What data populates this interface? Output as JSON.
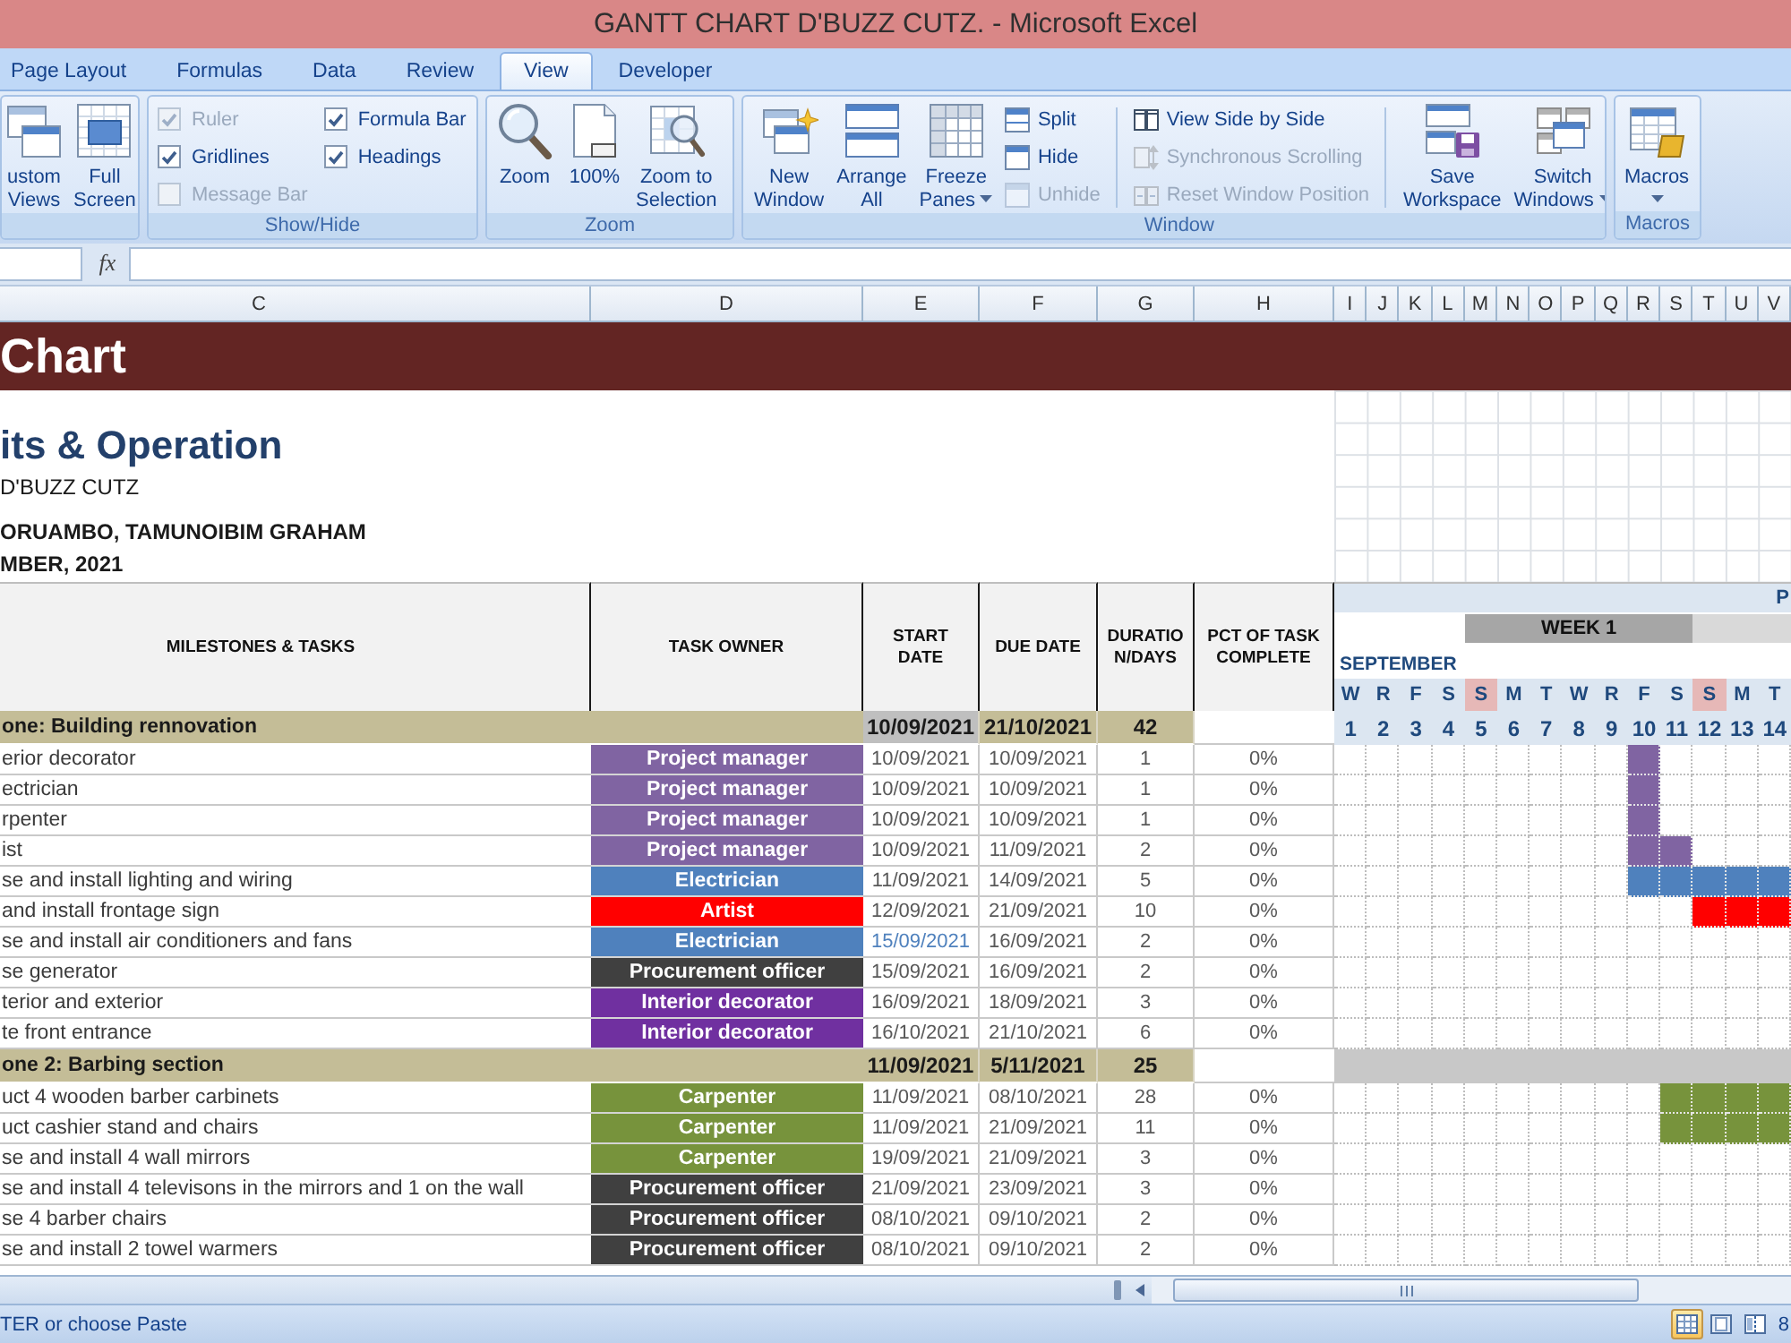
{
  "window": {
    "title": "GANTT CHART D'BUZZ CUTZ. - Microsoft Excel"
  },
  "tabs": [
    {
      "label": "Page Layout",
      "selected": false
    },
    {
      "label": "Formulas",
      "selected": false
    },
    {
      "label": "Data",
      "selected": false
    },
    {
      "label": "Review",
      "selected": false
    },
    {
      "label": "View",
      "selected": true
    },
    {
      "label": "Developer",
      "selected": false
    }
  ],
  "ribbon_groups": [
    {
      "items": [
        {
          "kind": "large",
          "lines": [
            "ustom",
            "Views"
          ],
          "dropdown": false,
          "disabled": false
        },
        {
          "kind": "large",
          "lines": [
            "Full",
            "Screen"
          ],
          "dropdown": false,
          "disabled": false
        }
      ]
    },
    {
      "label": "Show/Hide",
      "items": [
        {
          "kind": "stack",
          "entries": [
            {
              "kind": "check",
              "label": "Ruler",
              "checked": true,
              "disabled": true
            },
            {
              "kind": "check",
              "label": "Gridlines",
              "checked": true,
              "disabled": false
            },
            {
              "kind": "check",
              "label": "Message Bar",
              "checked": false,
              "disabled": true
            }
          ]
        },
        {
          "kind": "stack",
          "entries": [
            {
              "kind": "check",
              "label": "Formula Bar",
              "checked": true,
              "disabled": false
            },
            {
              "kind": "check",
              "label": "Headings",
              "checked": true,
              "disabled": false
            }
          ]
        }
      ]
    },
    {
      "label": "Zoom",
      "items": [
        {
          "kind": "large",
          "lines": [
            "Zoom"
          ],
          "dropdown": false,
          "disabled": false
        },
        {
          "kind": "large",
          "lines": [
            "100%"
          ],
          "dropdown": false,
          "disabled": false
        },
        {
          "kind": "large",
          "lines": [
            "Zoom to",
            "Selection"
          ],
          "dropdown": false,
          "disabled": false
        }
      ]
    },
    {
      "label": "Window",
      "items": [
        {
          "kind": "large",
          "lines": [
            "New",
            "Window"
          ],
          "dropdown": false,
          "disabled": false
        },
        {
          "kind": "large",
          "lines": [
            "Arrange",
            "All"
          ],
          "dropdown": false,
          "disabled": false
        },
        {
          "kind": "large",
          "lines": [
            "Freeze",
            "Panes"
          ],
          "dropdown": true,
          "disabled": false
        },
        {
          "kind": "stack",
          "entries": [
            {
              "kind": "small",
              "label": "Split",
              "disabled": false
            },
            {
              "kind": "small",
              "label": "Hide",
              "disabled": false
            },
            {
              "kind": "small",
              "label": "Unhide",
              "disabled": true
            }
          ]
        },
        {
          "kind": "divider"
        },
        {
          "kind": "stack",
          "entries": [
            {
              "kind": "small",
              "label": "View Side by Side",
              "disabled": false
            },
            {
              "kind": "small",
              "label": "Synchronous Scrolling",
              "disabled": true
            },
            {
              "kind": "small",
              "label": "Reset Window Position",
              "disabled": true
            }
          ]
        },
        {
          "kind": "divider"
        },
        {
          "kind": "large",
          "lines": [
            "Save",
            "Workspace"
          ],
          "dropdown": false,
          "disabled": false
        },
        {
          "kind": "large",
          "lines": [
            "Switch",
            "Windows"
          ],
          "dropdown": true,
          "disabled": false
        }
      ]
    },
    {
      "label": "Macros",
      "items": [
        {
          "kind": "large",
          "lines": [
            "Macros"
          ],
          "dropdown": true,
          "disabled": false
        }
      ]
    }
  ],
  "formula_bar": {
    "function_label": "fx"
  },
  "sheet": {
    "column_headers": [
      "C",
      "D",
      "E",
      "F",
      "G",
      "H",
      "I",
      "J",
      "K",
      "L",
      "M",
      "N",
      "O",
      "P",
      "Q",
      "R",
      "S",
      "T",
      "U",
      "V"
    ],
    "banner": "Chart",
    "info": [
      {
        "kind": "heading",
        "text": "its & Operation"
      },
      {
        "kind": "plain",
        "text": "D'BUZZ CUTZ"
      },
      {
        "kind": "bold",
        "text": "ORUAMBO, TAMUNOIBIM GRAHAM"
      },
      {
        "kind": "bold",
        "text": "MBER, 2021"
      }
    ],
    "headings": [
      "MILESTONES & TASKS",
      "TASK OWNER",
      "START\nDATE",
      "DUE DATE",
      "DURATIO\nN/DAYS",
      "PCT OF TASK\nCOMPLETE"
    ],
    "timeline": {
      "heading": "P",
      "weeks": [
        {
          "label": "WEEK 1",
          "color": "#a6a6a6"
        },
        {
          "color": "#d9d9d9"
        }
      ],
      "month": "SEPTEMBER",
      "days": [
        {
          "letter": "W",
          "number": "1",
          "highlighted": false
        },
        {
          "letter": "R",
          "number": "2",
          "highlighted": false
        },
        {
          "letter": "F",
          "number": "3",
          "highlighted": false
        },
        {
          "letter": "S",
          "number": "4",
          "highlighted": false
        },
        {
          "letter": "S",
          "number": "5",
          "highlighted": true
        },
        {
          "letter": "M",
          "number": "6",
          "highlighted": false
        },
        {
          "letter": "T",
          "number": "7",
          "highlighted": false
        },
        {
          "letter": "W",
          "number": "8",
          "highlighted": false
        },
        {
          "letter": "R",
          "number": "9",
          "highlighted": false
        },
        {
          "letter": "F",
          "number": "10",
          "highlighted": false
        },
        {
          "letter": "S",
          "number": "11",
          "highlighted": false
        },
        {
          "letter": "S",
          "number": "12",
          "highlighted": true
        },
        {
          "letter": "M",
          "number": "13",
          "highlighted": false
        },
        {
          "letter": "T",
          "number": "14",
          "highlighted": false
        }
      ]
    },
    "rows": [
      {
        "kind": "milestone",
        "name": "one: Building rennovation",
        "start": "10/09/2021",
        "due": "21/10/2021",
        "duration": "42",
        "start_highlighted": true
      },
      {
        "kind": "task",
        "name": "erior decorator",
        "owner": "Project manager",
        "color": "#8064a2",
        "start": "10/09/2021",
        "due": "10/09/2021",
        "duration": "1",
        "pct": "0%",
        "start_highlighted": false,
        "timeline": [
          false,
          false,
          false,
          false,
          false,
          false,
          false,
          false,
          false,
          true,
          false,
          false,
          false,
          false
        ]
      },
      {
        "kind": "task",
        "name": "ectrician",
        "owner": "Project manager",
        "color": "#8064a2",
        "start": "10/09/2021",
        "due": "10/09/2021",
        "duration": "1",
        "pct": "0%",
        "start_highlighted": false,
        "timeline": [
          false,
          false,
          false,
          false,
          false,
          false,
          false,
          false,
          false,
          true,
          false,
          false,
          false,
          false
        ]
      },
      {
        "kind": "task",
        "name": "rpenter",
        "owner": "Project manager",
        "color": "#8064a2",
        "start": "10/09/2021",
        "due": "10/09/2021",
        "duration": "1",
        "pct": "0%",
        "start_highlighted": false,
        "timeline": [
          false,
          false,
          false,
          false,
          false,
          false,
          false,
          false,
          false,
          true,
          false,
          false,
          false,
          false
        ]
      },
      {
        "kind": "task",
        "name": "ist",
        "owner": "Project manager",
        "color": "#8064a2",
        "start": "10/09/2021",
        "due": "11/09/2021",
        "duration": "2",
        "pct": "0%",
        "start_highlighted": false,
        "timeline": [
          false,
          false,
          false,
          false,
          false,
          false,
          false,
          false,
          false,
          true,
          true,
          false,
          false,
          false
        ]
      },
      {
        "kind": "task",
        "name": "se and install lighting and wiring",
        "owner": "Electrician",
        "color": "#4f81bd",
        "start": "11/09/2021",
        "due": "14/09/2021",
        "duration": "5",
        "pct": "0%",
        "start_highlighted": false,
        "timeline": [
          false,
          false,
          false,
          false,
          false,
          false,
          false,
          false,
          false,
          true,
          true,
          true,
          true,
          true
        ]
      },
      {
        "kind": "task",
        "name": "and install frontage sign",
        "owner": "Artist",
        "color": "#ff0000",
        "start": "12/09/2021",
        "due": "21/09/2021",
        "duration": "10",
        "pct": "0%",
        "start_highlighted": false,
        "timeline": [
          false,
          false,
          false,
          false,
          false,
          false,
          false,
          false,
          false,
          false,
          false,
          true,
          true,
          true
        ]
      },
      {
        "kind": "task",
        "name": "se and install air conditioners and fans",
        "owner": "Electrician",
        "color": "#4f81bd",
        "start": "15/09/2021",
        "due": "16/09/2021",
        "duration": "2",
        "pct": "0%",
        "start_highlighted": true,
        "timeline": [
          false,
          false,
          false,
          false,
          false,
          false,
          false,
          false,
          false,
          false,
          false,
          false,
          false,
          false
        ]
      },
      {
        "kind": "task",
        "name": "se generator",
        "owner": "Procurement officer",
        "color": "#404040",
        "start": "15/09/2021",
        "due": "16/09/2021",
        "duration": "2",
        "pct": "0%",
        "start_highlighted": false,
        "timeline": [
          false,
          false,
          false,
          false,
          false,
          false,
          false,
          false,
          false,
          false,
          false,
          false,
          false,
          false
        ]
      },
      {
        "kind": "task",
        "name": "terior and exterior",
        "owner": "Interior decorator",
        "color": "#7030a0",
        "start": "16/09/2021",
        "due": "18/09/2021",
        "duration": "3",
        "pct": "0%",
        "start_highlighted": false,
        "timeline": [
          false,
          false,
          false,
          false,
          false,
          false,
          false,
          false,
          false,
          false,
          false,
          false,
          false,
          false
        ]
      },
      {
        "kind": "task",
        "name": "te front entrance",
        "owner": "Interior decorator",
        "color": "#7030a0",
        "start": "16/10/2021",
        "due": "21/10/2021",
        "duration": "6",
        "pct": "0%",
        "start_highlighted": false,
        "timeline": [
          false,
          false,
          false,
          false,
          false,
          false,
          false,
          false,
          false,
          false,
          false,
          false,
          false,
          false
        ]
      },
      {
        "kind": "milestone",
        "name": "one 2: Barbing section",
        "start": "11/09/2021",
        "due": "5/11/2021",
        "duration": "25",
        "start_highlighted": false
      },
      {
        "kind": "task",
        "name": "uct 4 wooden barber carbinets",
        "owner": "Carpenter",
        "color": "#77933c",
        "start": "11/09/2021",
        "due": "08/10/2021",
        "duration": "28",
        "pct": "0%",
        "start_highlighted": false,
        "timeline": [
          false,
          false,
          false,
          false,
          false,
          false,
          false,
          false,
          false,
          false,
          true,
          true,
          true,
          true
        ]
      },
      {
        "kind": "task",
        "name": "uct cashier stand and chairs",
        "owner": "Carpenter",
        "color": "#77933c",
        "start": "11/09/2021",
        "due": "21/09/2021",
        "duration": "11",
        "pct": "0%",
        "start_highlighted": false,
        "timeline": [
          false,
          false,
          false,
          false,
          false,
          false,
          false,
          false,
          false,
          false,
          true,
          true,
          true,
          true
        ]
      },
      {
        "kind": "task",
        "name": "se and install 4 wall mirrors",
        "owner": "Carpenter",
        "color": "#77933c",
        "start": "19/09/2021",
        "due": "21/09/2021",
        "duration": "3",
        "pct": "0%",
        "start_highlighted": false,
        "timeline": [
          false,
          false,
          false,
          false,
          false,
          false,
          false,
          false,
          false,
          false,
          false,
          false,
          false,
          false
        ]
      },
      {
        "kind": "task",
        "name": "se and install 4 televisons in the mirrors and 1 on the wall",
        "owner": "Procurement officer",
        "color": "#404040",
        "start": "21/09/2021",
        "due": "23/09/2021",
        "duration": "3",
        "pct": "0%",
        "start_highlighted": false,
        "timeline": [
          false,
          false,
          false,
          false,
          false,
          false,
          false,
          false,
          false,
          false,
          false,
          false,
          false,
          false
        ]
      },
      {
        "kind": "task",
        "name": "se 4 barber chairs",
        "owner": "Procurement officer",
        "color": "#404040",
        "start": "08/10/2021",
        "due": "09/10/2021",
        "duration": "2",
        "pct": "0%",
        "start_highlighted": false,
        "timeline": [
          false,
          false,
          false,
          false,
          false,
          false,
          false,
          false,
          false,
          false,
          false,
          false,
          false,
          false
        ]
      },
      {
        "kind": "task",
        "name": "se and install 2 towel warmers",
        "owner": "Procurement officer",
        "color": "#404040",
        "start": "08/10/2021",
        "due": "09/10/2021",
        "duration": "2",
        "pct": "0%",
        "start_highlighted": false,
        "timeline": [
          false,
          false,
          false,
          false,
          false,
          false,
          false,
          false,
          false,
          false,
          false,
          false,
          false,
          false
        ]
      }
    ]
  },
  "status_bar": {
    "message": "TER or choose Paste",
    "view_buttons": [
      {
        "selected": true
      },
      {
        "selected": false
      },
      {
        "selected": false
      }
    ],
    "zoom": "8"
  }
}
